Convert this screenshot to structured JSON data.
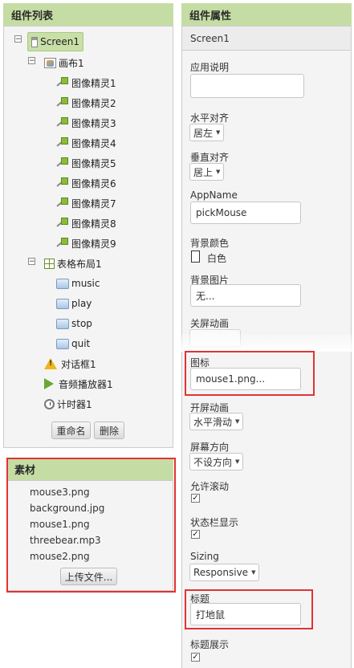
{
  "components_panel": {
    "title": "组件列表",
    "tree": [
      {
        "label": "Screen1",
        "icon": "screen-icon"
      },
      {
        "label": "画布1",
        "icon": "canvas-icon"
      },
      {
        "label": "图像精灵1"
      },
      {
        "label": "图像精灵2"
      },
      {
        "label": "图像精灵3"
      },
      {
        "label": "图像精灵4"
      },
      {
        "label": "图像精灵5"
      },
      {
        "label": "图像精灵6"
      },
      {
        "label": "图像精灵7"
      },
      {
        "label": "图像精灵8"
      },
      {
        "label": "图像精灵9"
      },
      {
        "label": "表格布局1",
        "icon": "table-layout-icon"
      },
      {
        "label": "music"
      },
      {
        "label": "play"
      },
      {
        "label": "stop"
      },
      {
        "label": "quit"
      },
      {
        "label": "对话框1",
        "icon": "warning-icon"
      },
      {
        "label": "音频播放器1",
        "icon": "play-icon"
      },
      {
        "label": "计时器1",
        "icon": "clock-icon"
      }
    ],
    "rename_button": "重命名",
    "delete_button": "删除"
  },
  "media_panel": {
    "title": "素材",
    "files": [
      "mouse3.png",
      "background.jpg",
      "mouse1.png",
      "threebear.mp3",
      "mouse2.png"
    ],
    "upload_button": "上传文件..."
  },
  "properties_panel": {
    "title": "组件属性",
    "component_name": "Screen1",
    "about_label": "应用说明",
    "align_h_label": "水平对齐",
    "align_h_value": "居左",
    "align_v_label": "垂直对齐",
    "align_v_value": "居上",
    "appname_label": "AppName",
    "appname_value": "pickMouse",
    "bgcolor_label": "背景颜色",
    "bgcolor_value": "白色",
    "bgimage_label": "背景图片",
    "bgimage_value": "无...",
    "close_anim_label": "关屏动画",
    "icon_label": "图标",
    "icon_value": "mouse1.png...",
    "open_anim_label": "开屏动画",
    "open_anim_value": "水平滑动",
    "orientation_label": "屏幕方向",
    "orientation_value": "不设方向",
    "scrollable_label": "允许滚动",
    "statusbar_label": "状态栏显示",
    "sizing_label": "Sizing",
    "sizing_value": "Responsive",
    "title_label": "标题",
    "title_value": "打地鼠",
    "show_title_label": "标题展示"
  },
  "colors": {
    "header_bg": "#c5dda4",
    "panel_bg": "#f4f4f4",
    "highlight": "#e03333",
    "selected": "#c8e0a7"
  }
}
